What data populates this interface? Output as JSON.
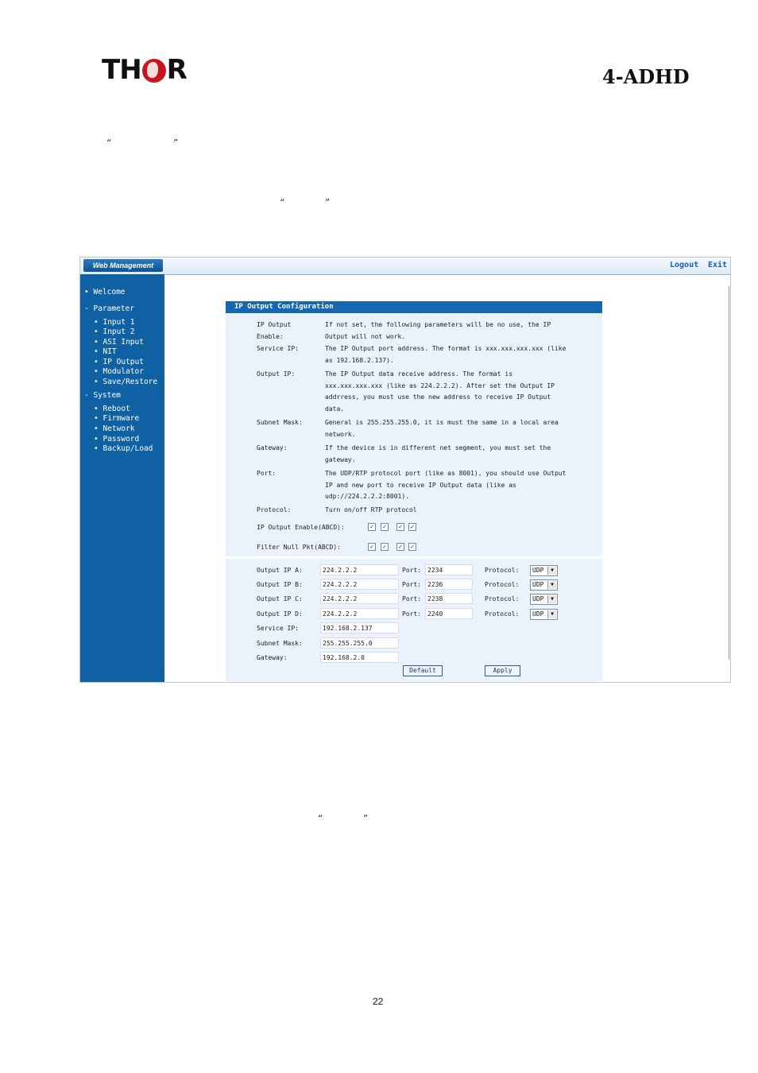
{
  "header": {
    "logo_text_left": "TH",
    "logo_text_right": "R",
    "model": "4-ADHD"
  },
  "quotes": {
    "open": "“",
    "close": "”"
  },
  "app": {
    "tab_label": "Web Management",
    "logout": "Logout",
    "exit": "Exit",
    "nav": {
      "welcome": "Welcome",
      "parameter": "Parameter",
      "parameter_items": [
        "Input 1",
        "Input 2",
        "ASI Input",
        "NIT",
        "IP Output",
        "Modulator",
        "Save/Restore"
      ],
      "system": "System",
      "system_items": [
        "Reboot",
        "Firmware",
        "Network",
        "Password",
        "Backup/Load"
      ],
      "bullet": "•",
      "expand": "-"
    },
    "panel": {
      "title": "IP Output Configuration",
      "help": [
        {
          "label": "IP Output Enable:",
          "text": "If not set, the following parameters will be no use, the IP Output will not work."
        },
        {
          "label": "Service IP:",
          "text": "The IP Output port address. The format is xxx.xxx.xxx.xxx (like as 192.168.2.137)."
        },
        {
          "label": "Output IP:",
          "text": "The IP Output data receive address. The format is xxx.xxx.xxx.xxx (like as 224.2.2.2). After set the Output IP addrress, you must use the new address to receive IP Output data."
        },
        {
          "label": "Subnet Mask:",
          "text": "General is 255.255.255.0, it is must the same in a local area network."
        },
        {
          "label": "Gateway:",
          "text": "If the device is in different net segment, you must set the gateway."
        },
        {
          "label": "Port:",
          "text": "The UDP/RTP protocol port (like as 8001), you should use Output IP and new port to receive IP Output data (like as udp://224.2.2.2:8001)."
        },
        {
          "label": "Protocol:",
          "text": "Turn on/off RTP protocol"
        }
      ],
      "enable_label": "IP Output Enable(ABCD):",
      "nullpkt_label": "Filter Null Pkt(ABCD):",
      "check_mark": "✓",
      "outputs": [
        {
          "label": "Output IP A:",
          "ip": "224.2.2.2",
          "port_label": "Port:",
          "port": "2234",
          "proto_label": "Protocol:",
          "proto": "UDP"
        },
        {
          "label": "Output IP B:",
          "ip": "224.2.2.2",
          "port_label": "Port:",
          "port": "2236",
          "proto_label": "Protocol:",
          "proto": "UDP"
        },
        {
          "label": "Output IP C:",
          "ip": "224.2.2.2",
          "port_label": "Port:",
          "port": "2238",
          "proto_label": "Protocol:",
          "proto": "UDP"
        },
        {
          "label": "Output IP D:",
          "ip": "224.2.2.2",
          "port_label": "Port:",
          "port": "2240",
          "proto_label": "Protocol:",
          "proto": "UDP"
        }
      ],
      "service_ip_label": "Service IP:",
      "service_ip": "192.168.2.137",
      "subnet_label": "Subnet Mask:",
      "subnet": "255.255.255.0",
      "gateway_label": "Gateway:",
      "gateway": "192.168.2.0",
      "default_btn": "Default",
      "apply_btn": "Apply"
    }
  },
  "page_number": "22"
}
